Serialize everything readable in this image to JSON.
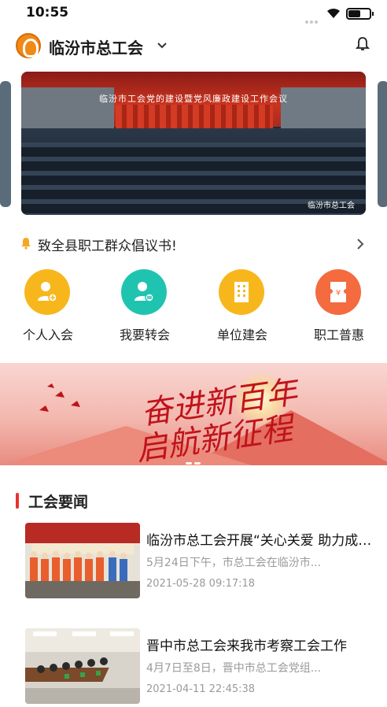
{
  "status": {
    "time": "10:55"
  },
  "header": {
    "title": "临汾市总工会"
  },
  "banner": {
    "stage_text": "临汾市工会党的建设暨党风廉政建设工作会议",
    "watermark": "临汾市总工会"
  },
  "notice": {
    "text": "致全县职工群众倡议书!"
  },
  "quick_actions": [
    {
      "label": "个人入会",
      "color": "#f7b71c",
      "icon": "person-add-icon"
    },
    {
      "label": "我要转会",
      "color": "#1fc4b0",
      "icon": "person-transfer-icon"
    },
    {
      "label": "单位建会",
      "color": "#f7b71c",
      "icon": "building-icon"
    },
    {
      "label": "职工普惠",
      "color": "#f36b3e",
      "icon": "ticket-icon"
    }
  ],
  "promo": {
    "line1": "奋进新百年",
    "line2": "启航新征程"
  },
  "section": {
    "title": "工会要闻"
  },
  "news": [
    {
      "title": "临汾市总工会开展“关心关爱 助力成长”",
      "summary": "5月24日下午，市总工会在临汾市...",
      "date": "2021-05-28 09:17:18"
    },
    {
      "title": "晋中市总工会来我市考察工会工作",
      "summary": "4月7日至8日，晋中市总工会党组...",
      "date": "2021-04-11 22:45:38"
    }
  ]
}
